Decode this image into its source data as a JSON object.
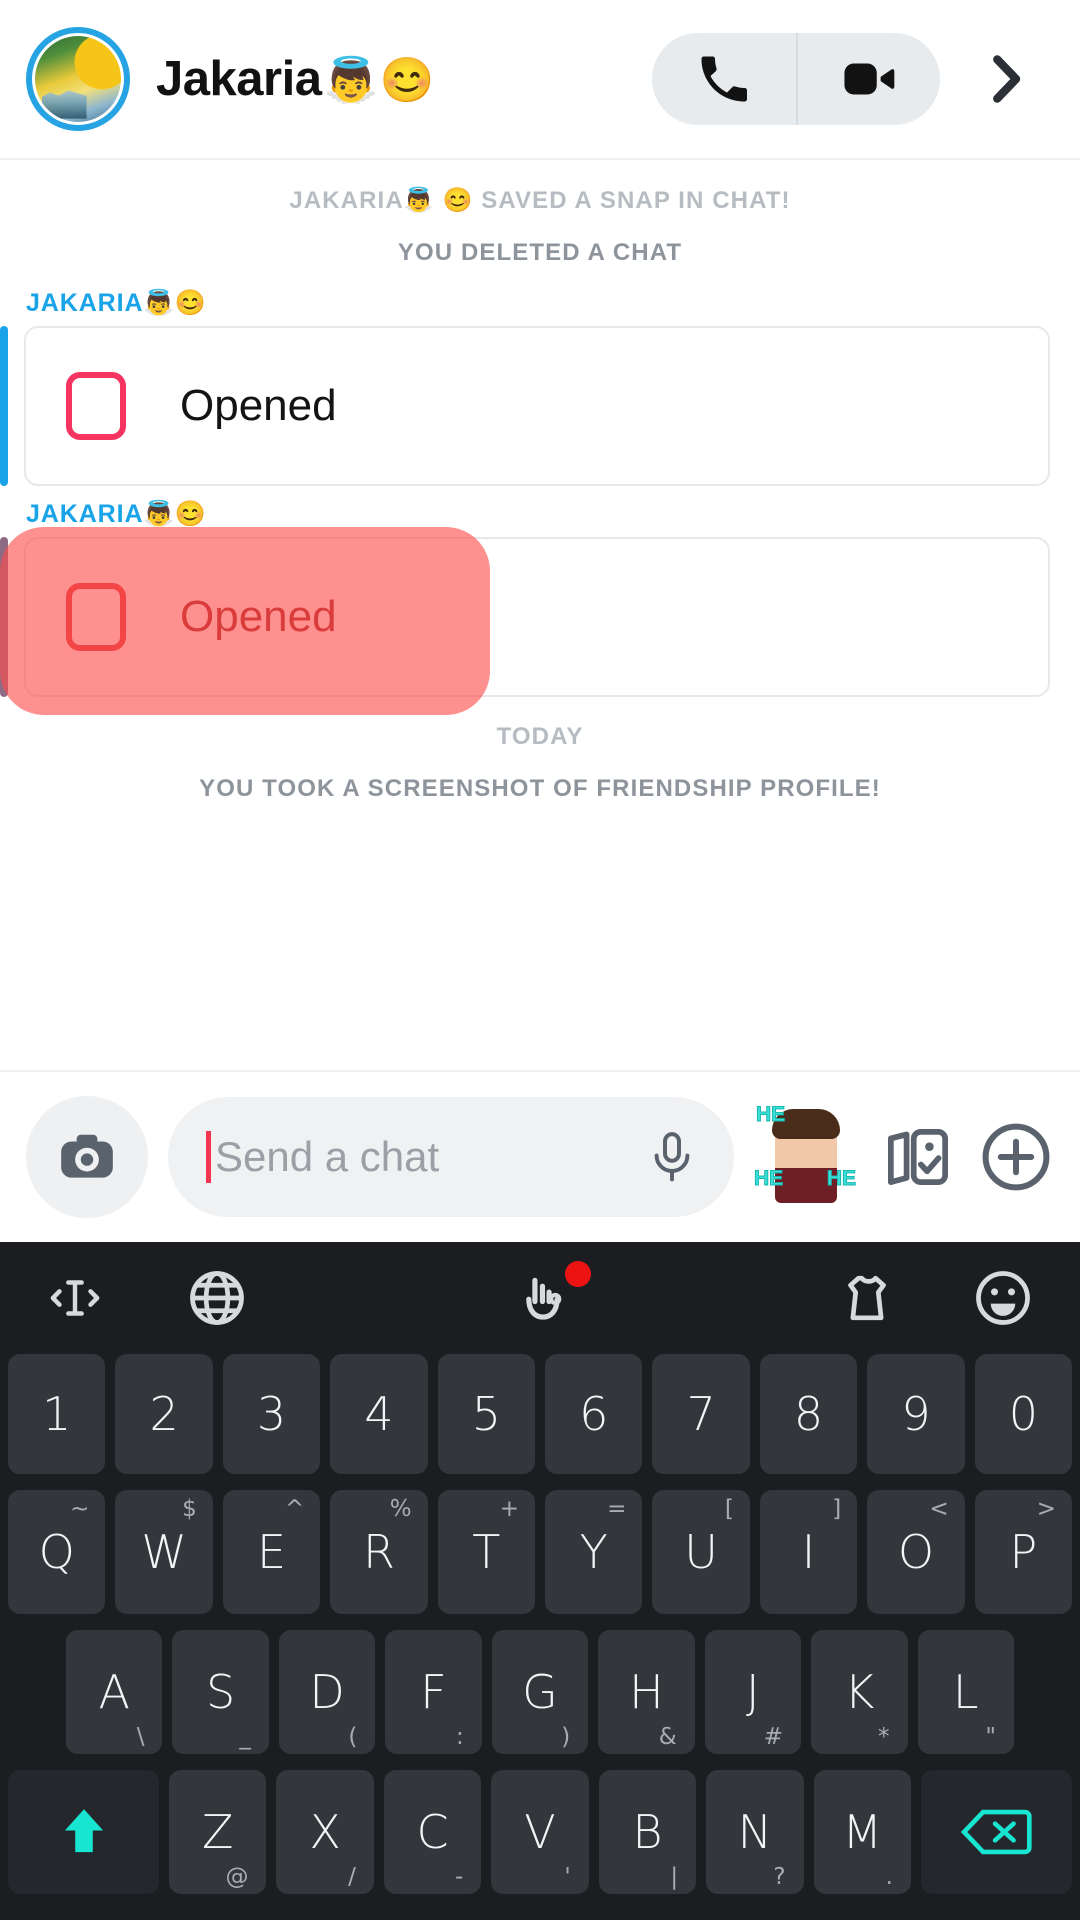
{
  "header": {
    "contact_name": "Jakaria",
    "contact_emoji_1": "👼",
    "contact_emoji_2": "😊",
    "avatar_name": "contact-avatar",
    "call_icon": "phone-icon",
    "video_icon": "video-camera-icon",
    "forward_icon": "chevron-right-icon"
  },
  "chat": {
    "system_messages": [
      {
        "text": "JAKARIA👼 😊 SAVED A SNAP IN CHAT!"
      },
      {
        "text": "YOU DELETED A CHAT"
      }
    ],
    "messages": [
      {
        "sender": "JAKARIA",
        "sender_emoji_1": "👼",
        "sender_emoji_2": "😊",
        "status": "Opened",
        "icon": "opened-snap-icon",
        "selected": false,
        "accent_color": "#19a3e8"
      },
      {
        "sender": "JAKARIA",
        "sender_emoji_1": "👼",
        "sender_emoji_2": "😊",
        "status": "Opened",
        "icon": "opened-snap-icon",
        "selected": true,
        "accent_color": "#8e6b84",
        "selection_color": "#ff4c4c"
      }
    ],
    "day_divider": "TODAY",
    "screenshot_notice": "YOU TOOK A SCREENSHOT OF FRIENDSHIP PROFILE!"
  },
  "input_bar": {
    "camera_icon": "camera-icon",
    "placeholder": "Send a chat",
    "mic_icon": "microphone-icon",
    "bitmoji_icon": "bitmoji-sticker",
    "bitmoji_text_1": "HE",
    "bitmoji_text_2": "HE",
    "bitmoji_text_3": "HE",
    "cards_icon": "sticker-cards-icon",
    "plus_icon": "plus-circle-icon"
  },
  "keyboard": {
    "toolbar": [
      {
        "icon": "cursor-move-icon",
        "badge": false
      },
      {
        "icon": "globe-language-icon",
        "badge": false
      },
      {
        "icon": "handwriting-icon",
        "badge": true
      },
      {
        "icon": "clothes-sticker-icon",
        "badge": false
      },
      {
        "icon": "emoji-icon",
        "badge": false
      }
    ],
    "rows": {
      "numbers": [
        {
          "main": "1"
        },
        {
          "main": "2"
        },
        {
          "main": "3"
        },
        {
          "main": "4"
        },
        {
          "main": "5"
        },
        {
          "main": "6"
        },
        {
          "main": "7"
        },
        {
          "main": "8"
        },
        {
          "main": "9"
        },
        {
          "main": "0"
        }
      ],
      "qwerty": [
        {
          "main": "Q",
          "sym": "~"
        },
        {
          "main": "W",
          "sym": "$"
        },
        {
          "main": "E",
          "sym": "^"
        },
        {
          "main": "R",
          "sym": "%"
        },
        {
          "main": "T",
          "sym": "+"
        },
        {
          "main": "Y",
          "sym": "="
        },
        {
          "main": "U",
          "sym": "["
        },
        {
          "main": "I",
          "sym": "]"
        },
        {
          "main": "O",
          "sym": "<"
        },
        {
          "main": "P",
          "sym": ">"
        }
      ],
      "asdf": [
        {
          "main": "A",
          "sym": "\\"
        },
        {
          "main": "S",
          "sym": "_"
        },
        {
          "main": "D",
          "sym": "("
        },
        {
          "main": "F",
          "sym": ":"
        },
        {
          "main": "G",
          "sym": ")"
        },
        {
          "main": "H",
          "sym": "&"
        },
        {
          "main": "J",
          "sym": "#"
        },
        {
          "main": "K",
          "sym": "*"
        },
        {
          "main": "L",
          "sym": "\""
        }
      ],
      "zxcv": [
        {
          "main": "Z",
          "sym": "@"
        },
        {
          "main": "X",
          "sym": "/"
        },
        {
          "main": "C",
          "sym": "-"
        },
        {
          "main": "V",
          "sym": "'"
        },
        {
          "main": "B",
          "sym": "|"
        },
        {
          "main": "N",
          "sym": "?"
        },
        {
          "main": "M",
          "sym": "."
        }
      ]
    },
    "shift_icon": "shift-arrow-icon",
    "backspace_icon": "backspace-icon",
    "accent_color": "#19e6d2"
  }
}
